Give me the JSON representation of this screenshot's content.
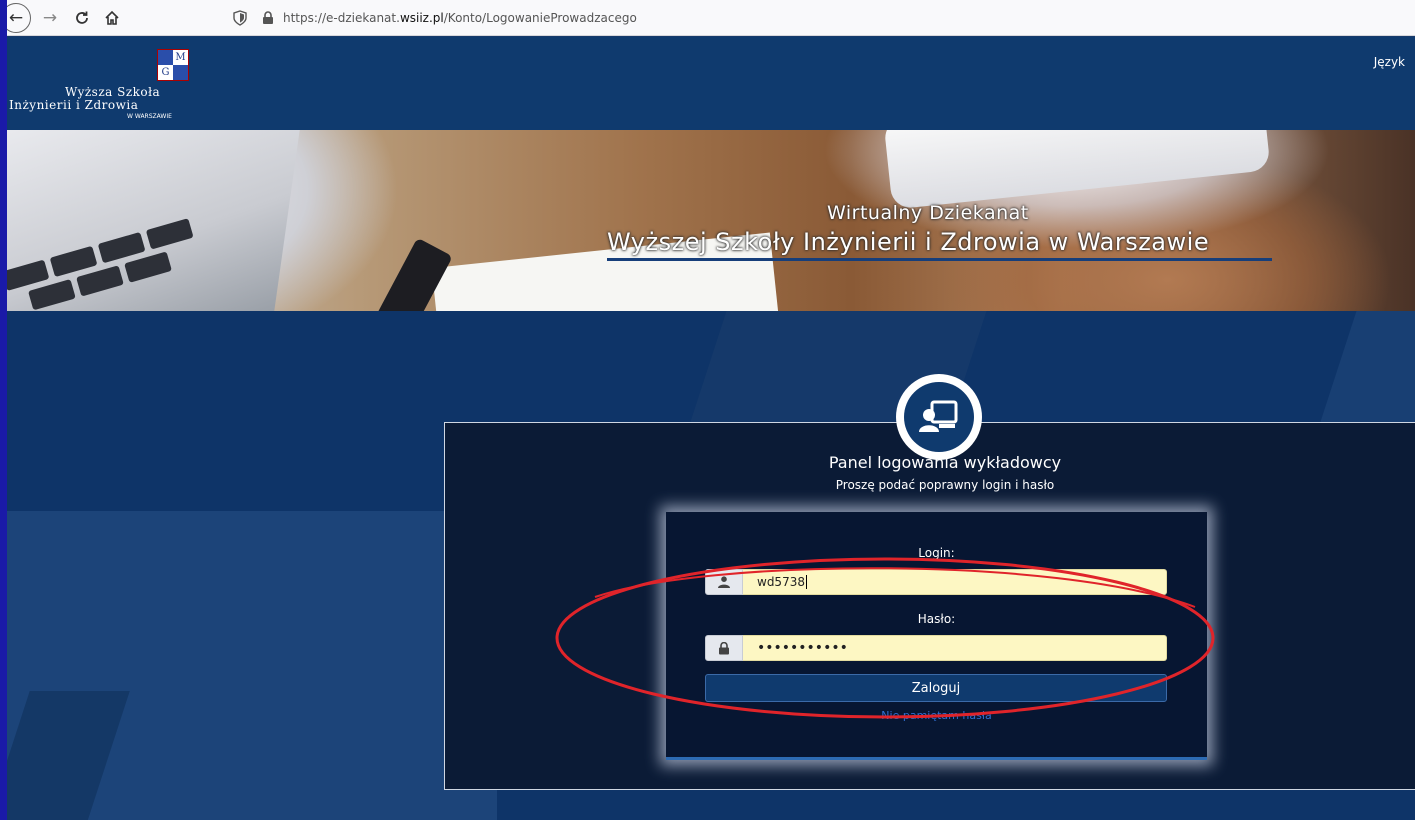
{
  "browser": {
    "url_prefix": "https://e-dziekanat.",
    "url_host": "wsiiz.pl",
    "url_path": "/Konto/LogowanieProwadzacego"
  },
  "header": {
    "logo_line1": "Wyższa Szkoła",
    "logo_line2": "Inżynierii i Zdrowia",
    "logo_line3": "W WARSZAWIE",
    "crest_letters": [
      "",
      "M",
      "G",
      ""
    ],
    "lang_label": "Język"
  },
  "banner": {
    "line1": "Wirtualny Dziekanat",
    "line2": "Wyższej Szkoły Inżynierii i Zdrowia w Warszawie"
  },
  "login": {
    "title": "Panel logowania wykładowcy",
    "subtitle": "Proszę podać poprawny login i hasło",
    "login_label": "Login:",
    "login_value": "wd5738",
    "password_label": "Hasło:",
    "password_value": "•••••••••••",
    "submit_label": "Zaloguj",
    "forgot_label": "Nie pamiętam hasła"
  },
  "colors": {
    "header_bg": "#0f3a6e",
    "panel_bg": "#0b1b36",
    "input_bg": "#fdf7c3",
    "annotation": "#e0242a"
  }
}
